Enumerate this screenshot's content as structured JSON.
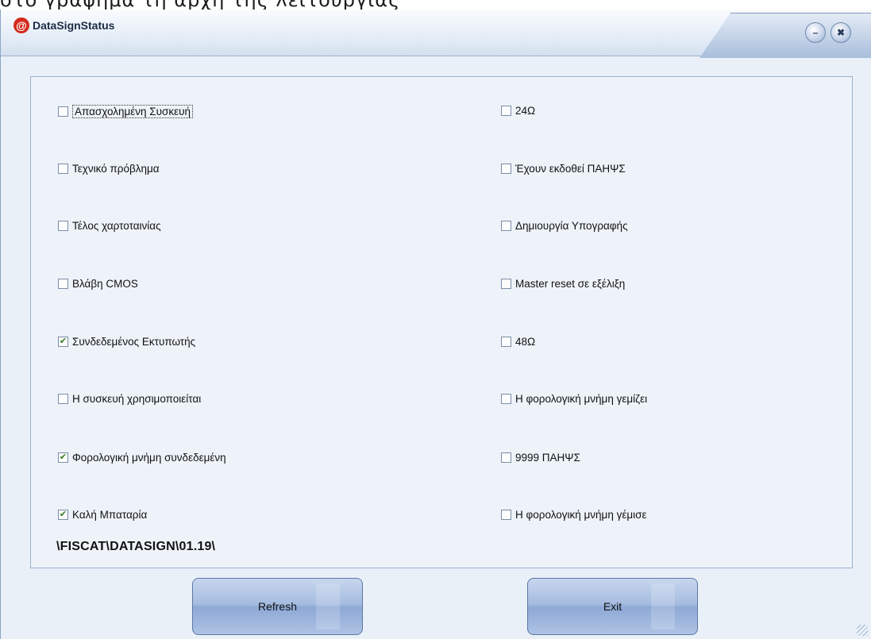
{
  "partial_top_text": "στο γράφημα τη αρχή της λειτουργίας",
  "window": {
    "title": "DataSignStatus",
    "icon": "app-logo-icon",
    "minimize_glyph": "–",
    "close_glyph": "✖"
  },
  "left_column": [
    {
      "label": "Απασχολημένη Συσκευή",
      "checked": false
    },
    {
      "label": "Τεχνικό πρόβλημα",
      "checked": false
    },
    {
      "label": "Τέλος χαρτοταινίας",
      "checked": false
    },
    {
      "label": "Βλάβη CMOS",
      "checked": false
    },
    {
      "label": "Συνδεδεμένος Εκτυπωτής",
      "checked": true
    },
    {
      "label": "Η συσκευή χρησιμοποιείται",
      "checked": false
    },
    {
      "label": "Φορολογική μνήμη συνδεδεμένη",
      "checked": true
    },
    {
      "label": "Καλή Μπαταρία",
      "checked": true
    }
  ],
  "right_column": [
    {
      "label": "24Ω",
      "checked": false
    },
    {
      "label": "Έχουν εκδοθεί ΠΑΗΨΣ",
      "checked": false
    },
    {
      "label": "Δημιουργία Υπογραφής",
      "checked": false
    },
    {
      "label": "Master reset σε εξέλιξη",
      "checked": false
    },
    {
      "label": "48Ω",
      "checked": false
    },
    {
      "label": "Η φορολογική μνήμη γεμίζει",
      "checked": false
    },
    {
      "label": "9999 ΠΑΗΨΣ",
      "checked": false
    },
    {
      "label": "Η φορολογική μνήμη γέμισε",
      "checked": false
    }
  ],
  "path_label": "\\FISCAT\\DATASIGN\\01.19\\",
  "buttons": {
    "refresh": "Refresh",
    "exit": "Exit"
  }
}
